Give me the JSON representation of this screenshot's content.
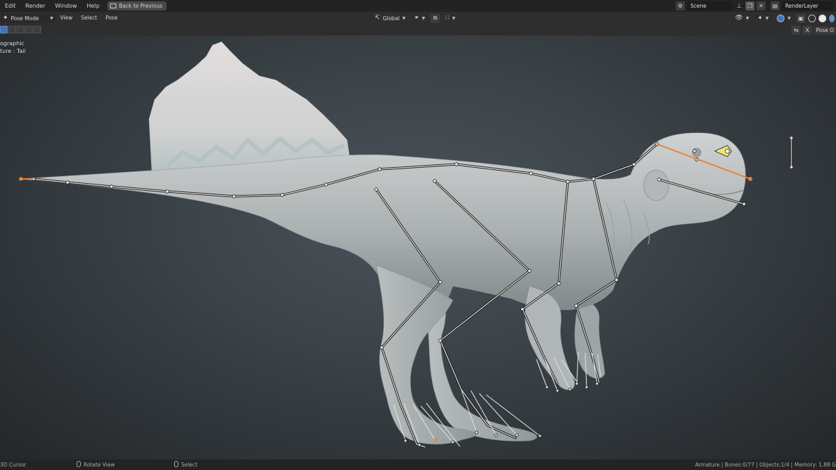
{
  "topbar": {
    "menus": [
      "Edit",
      "Render",
      "Window",
      "Help"
    ],
    "back_label": "Back to Previous",
    "scene_name": "Scene",
    "render_layer": "RenderLayer"
  },
  "header": {
    "mode": "Pose Mode",
    "menus": [
      "View",
      "Select",
      "Pose"
    ],
    "transform_orientation": "Global"
  },
  "tool_header": {
    "pose_options_label": "Pose O"
  },
  "viewport": {
    "view_name": "ographic",
    "active_object": "ture : Tail"
  },
  "statusbar": {
    "left_hint": "3D Cursor",
    "middle_hint": "Rotate View",
    "right_hint": "Select",
    "stats": "Armature | Bones:0/77 | Objects:1/4 | Memory: 1.88 G"
  },
  "colors": {
    "accent_blue": "#4772b3",
    "active_bone": "#e8843c",
    "mesh": "#b9bdbd"
  }
}
